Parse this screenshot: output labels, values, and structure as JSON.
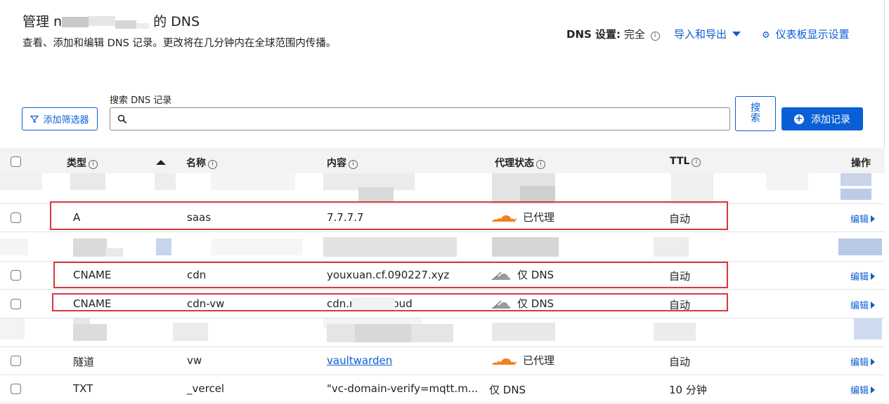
{
  "header": {
    "title_prefix": "管理 n",
    "title_suffix": "的 DNS",
    "description": "查看、添加和编辑 DNS 记录。更改将在几分钟内在全球范围内传播。",
    "dns_setting_label": "DNS 设置:",
    "dns_setting_value": "完全",
    "import_export": "导入和导出",
    "dashboard_settings": "仪表板显示设置"
  },
  "toolbar": {
    "search_label": "搜索 DNS 记录",
    "search_value": "",
    "filter_label": "添加筛选器",
    "search_button": "搜索",
    "add_record": "添加记录"
  },
  "table": {
    "columns": {
      "type": "类型",
      "name": "名称",
      "content": "内容",
      "proxy": "代理状态",
      "ttl": "TTL",
      "actions": "操作"
    },
    "edit_label": "编辑",
    "rows": [
      {
        "type": "A",
        "name": "saas",
        "content": "7.7.7.7",
        "proxy": "已代理",
        "proxied": true,
        "ttl": "自动",
        "highlighted": true
      },
      {
        "type": "CNAME",
        "name": "cdn",
        "content": "youxuan.cf.090227.xyz",
        "proxy": "仅 DNS",
        "proxied": false,
        "ttl": "自动",
        "highlighted": true
      },
      {
        "type": "CNAME",
        "name": "cdn-vw",
        "content": "cdn.r      h.cloud",
        "proxy": "仅 DNS",
        "proxied": false,
        "ttl": "自动",
        "highlighted": true
      },
      {
        "type": "隧道",
        "name": "vw",
        "content": "vaultwarden",
        "proxy": "已代理",
        "proxied": true,
        "ttl": "自动",
        "highlighted": false
      },
      {
        "type": "TXT",
        "name": "_vercel",
        "content": "\"vc-domain-verify=mqtt.m...",
        "proxy": "仅 DNS",
        "proxied": false,
        "ttl": "10 分钟",
        "highlighted": false
      }
    ]
  },
  "colors": {
    "accent": "#0a5fd6",
    "highlight": "#d9363e",
    "proxied_cloud": "#f38020",
    "dns_cloud": "#8a8a8a"
  }
}
